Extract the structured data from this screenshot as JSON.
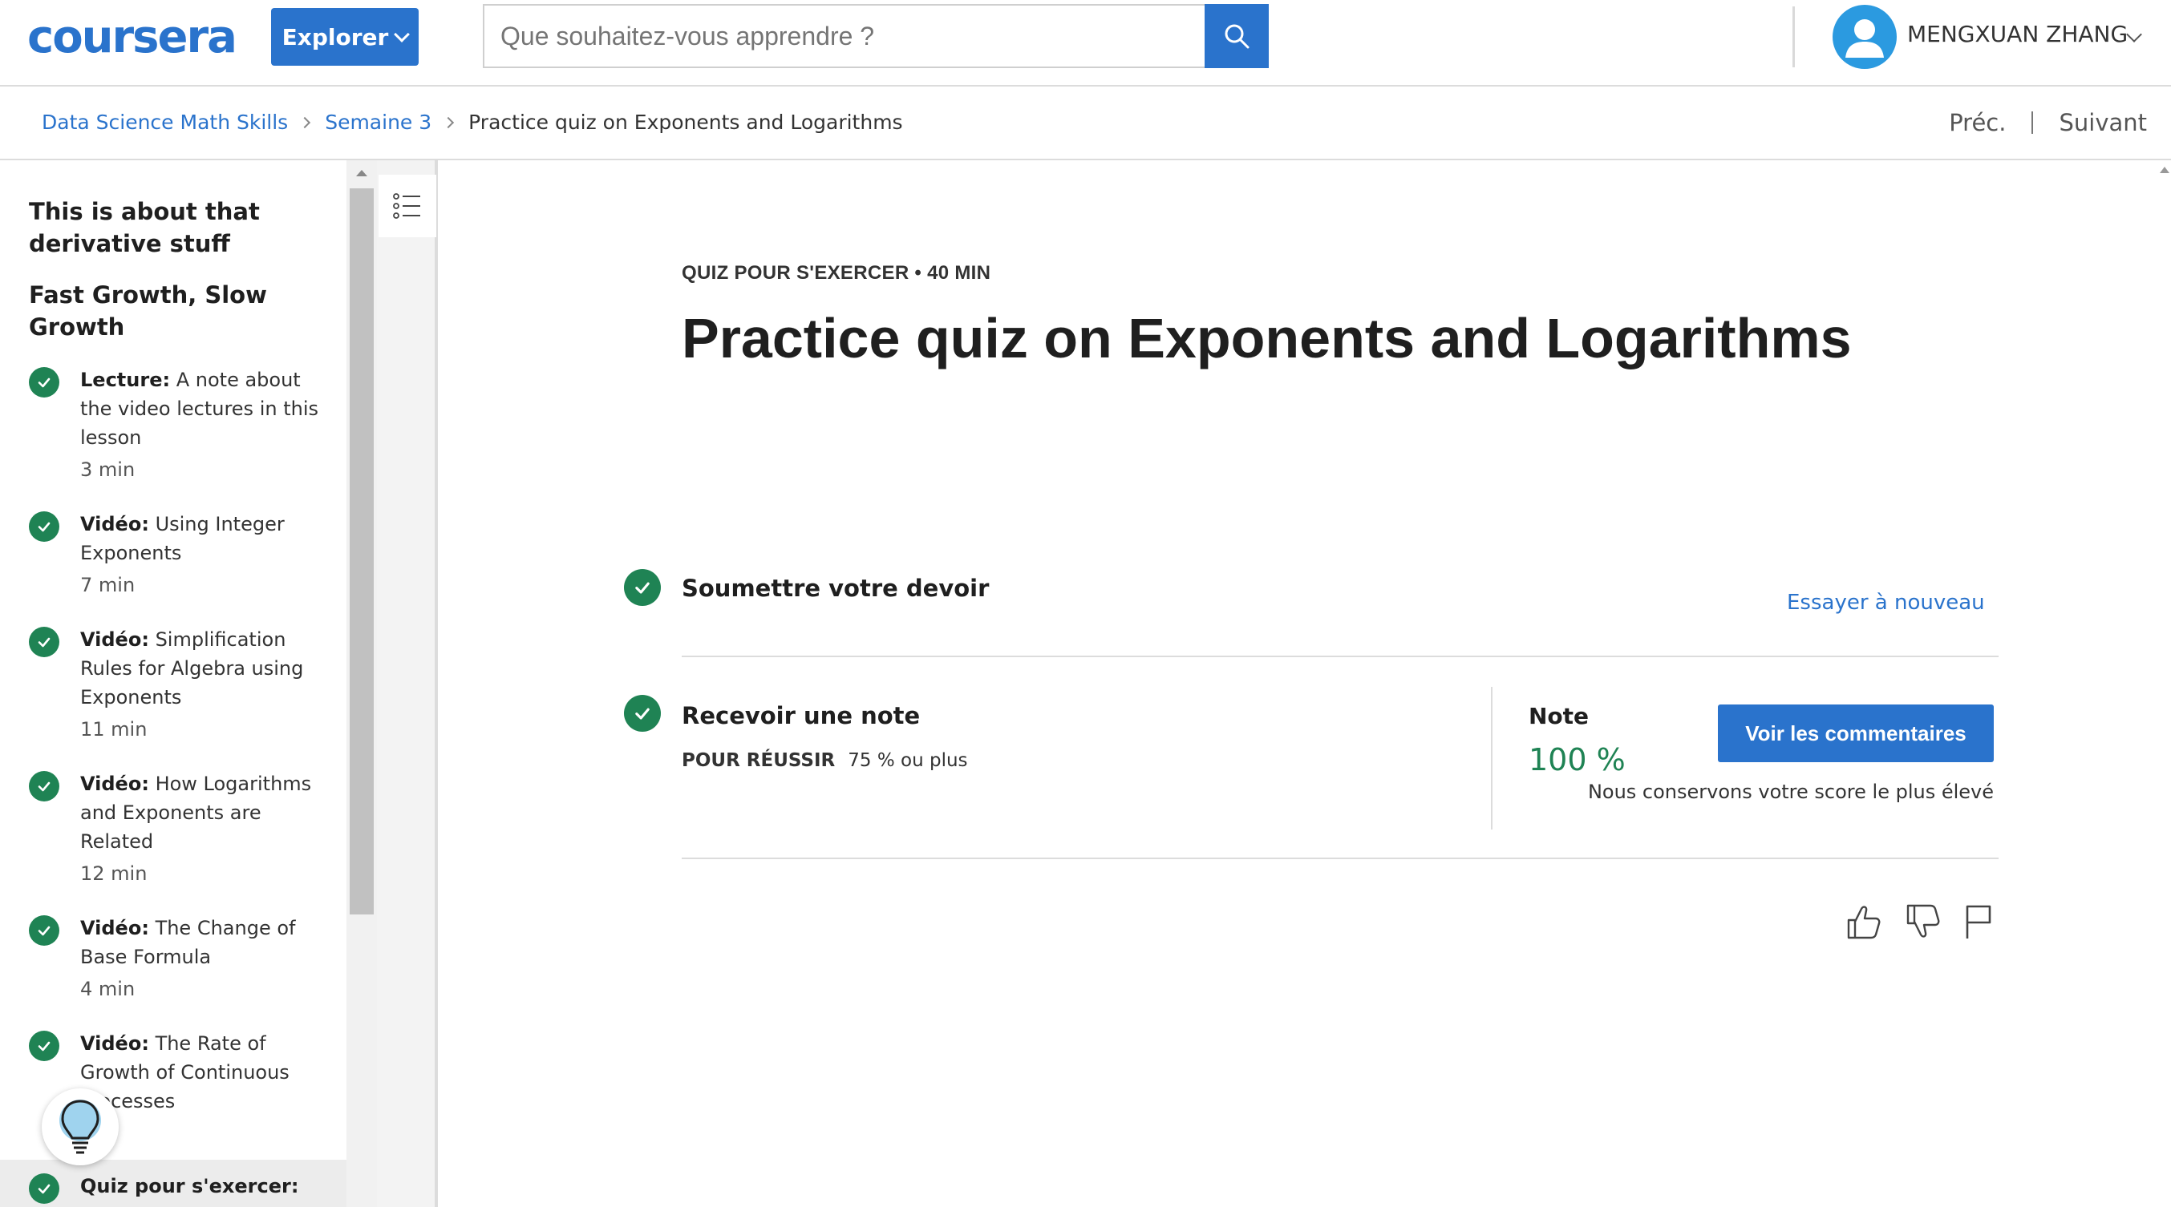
{
  "header": {
    "logo_text": "coursera",
    "explore_label": "Explorer",
    "search_placeholder": "Que souhaitez-vous apprendre ?",
    "user_name": "MENGXUAN ZHANG",
    "brand_color": "#2a73cc"
  },
  "breadcrumb": {
    "items": [
      "Data Science Math Skills",
      "Semaine 3",
      "Practice quiz on Exponents and Logarithms"
    ],
    "prev_label": "Préc.",
    "next_label": "Suivant"
  },
  "sidebar": {
    "headings": [
      "This is about that derivative stuff",
      "Fast Growth, Slow Growth"
    ],
    "items": [
      {
        "type": "Lecture:",
        "title": "A note about the video lectures in this lesson",
        "duration": "3  min"
      },
      {
        "type": "Vidéo:",
        "title": "Using Integer Exponents",
        "duration": "7  min"
      },
      {
        "type": "Vidéo:",
        "title": "Simplification Rules for Algebra using Exponents",
        "duration": "11  min"
      },
      {
        "type": "Vidéo:",
        "title": "How Logarithms and Exponents are Related",
        "duration": "12  min"
      },
      {
        "type": "Vidéo:",
        "title": "The Change of Base Formula",
        "duration": "4  min"
      },
      {
        "type": "Vidéo:",
        "title": "The Rate of Growth of Continuous Processes",
        "duration": "min"
      },
      {
        "type": "Quiz pour s'exercer:",
        "title": "",
        "duration": ""
      }
    ],
    "complete_color": "#1f8354"
  },
  "main": {
    "eyebrow": "QUIZ POUR S'EXERCER • 40  MIN",
    "title": "Practice quiz on Exponents and Logarithms",
    "submit": {
      "title": "Soumettre votre devoir",
      "retry_label": "Essayer à nouveau"
    },
    "grade": {
      "title": "Recevoir une note",
      "pass_label": "POUR RÉUSSIR",
      "pass_value": "75 % ou plus",
      "note_label": "Note",
      "note_value": "100 %",
      "feedback_label": "Voir les commentaires",
      "best_score_text": "Nous conservons votre score le plus élevé"
    },
    "feedback_icons": [
      "thumbs-up-icon",
      "thumbs-down-icon",
      "flag-icon"
    ]
  }
}
